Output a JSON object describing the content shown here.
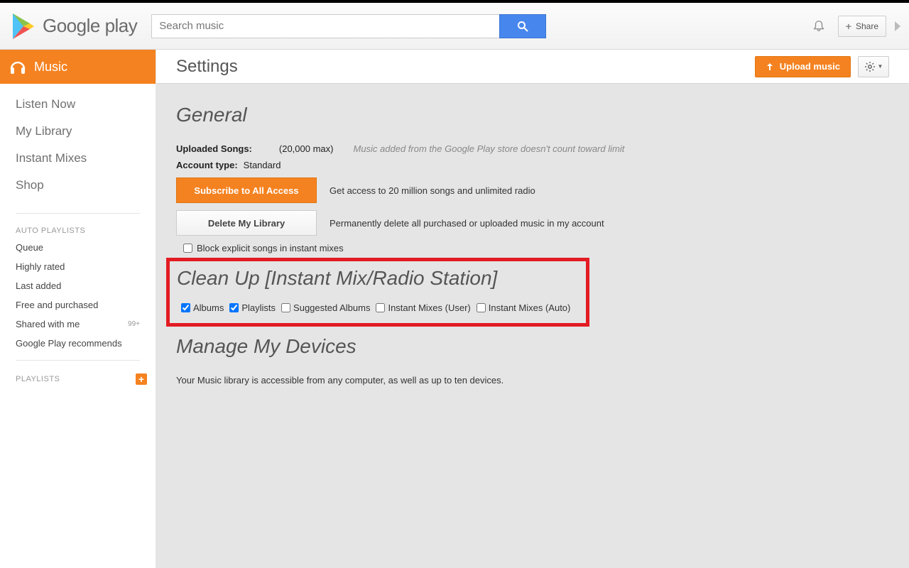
{
  "header": {
    "logo_text": "Google play",
    "search_placeholder": "Search music",
    "share_label": "Share"
  },
  "sidebar": {
    "music_label": "Music",
    "nav": [
      "Listen Now",
      "My Library",
      "Instant Mixes",
      "Shop"
    ],
    "auto_playlists_label": "AUTO PLAYLISTS",
    "auto_items": [
      {
        "label": "Queue"
      },
      {
        "label": "Highly rated"
      },
      {
        "label": "Last added"
      },
      {
        "label": "Free and purchased"
      },
      {
        "label": "Shared with me",
        "badge": "99+"
      },
      {
        "label": "Google Play recommends"
      }
    ],
    "playlists_label": "PLAYLISTS"
  },
  "page": {
    "title": "Settings",
    "upload_label": "Upload music"
  },
  "general": {
    "heading": "General",
    "uploaded_label": "Uploaded Songs:",
    "uploaded_max": "(20,000 max)",
    "uploaded_hint": "Music added from the Google Play store doesn't count toward limit",
    "account_type_label": "Account type:",
    "account_type_value": "Standard",
    "subscribe_btn": "Subscribe to All Access",
    "subscribe_hint": "Get access to 20 million songs and unlimited radio",
    "delete_btn": "Delete My Library",
    "delete_hint": "Permanently delete all purchased or uploaded music in my account",
    "block_explicit": "Block explicit songs in instant mixes"
  },
  "cleanup": {
    "heading": "Clean Up [Instant Mix/Radio Station]",
    "options": [
      {
        "label": "Albums",
        "checked": true
      },
      {
        "label": "Playlists",
        "checked": true
      },
      {
        "label": "Suggested Albums",
        "checked": false
      },
      {
        "label": "Instant Mixes (User)",
        "checked": false
      },
      {
        "label": "Instant Mixes (Auto)",
        "checked": false
      }
    ]
  },
  "devices": {
    "heading": "Manage My Devices",
    "desc": "Your Music library is accessible from any computer, as well as up to ten devices."
  }
}
